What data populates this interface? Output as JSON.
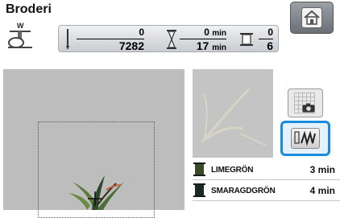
{
  "screen": {
    "title": "Broderi"
  },
  "info": {
    "stitch_done": "0",
    "stitch_total": "7282",
    "time_done": "0",
    "time_total": "17",
    "time_unit": "min",
    "color_done": "0",
    "color_total": "6"
  },
  "threads": [
    {
      "name": "LIMEGRÖN",
      "time": "3 min",
      "color": "#3a4a26"
    },
    {
      "name": "SMARAGDGRÖN",
      "time": "4 min",
      "color": "#1a2a22"
    }
  ],
  "icons": {
    "home": "home-icon",
    "presser_foot": "presser-foot-w-icon",
    "needle": "needle-icon",
    "hourglass": "hourglass-icon",
    "spool": "thread-spool-icon",
    "grid_camera": "grid-camera-icon",
    "simulator": "stitch-simulator-icon"
  },
  "colors": {
    "accent": "#1a8ce0",
    "edit_bg": "#bdbdbd"
  }
}
